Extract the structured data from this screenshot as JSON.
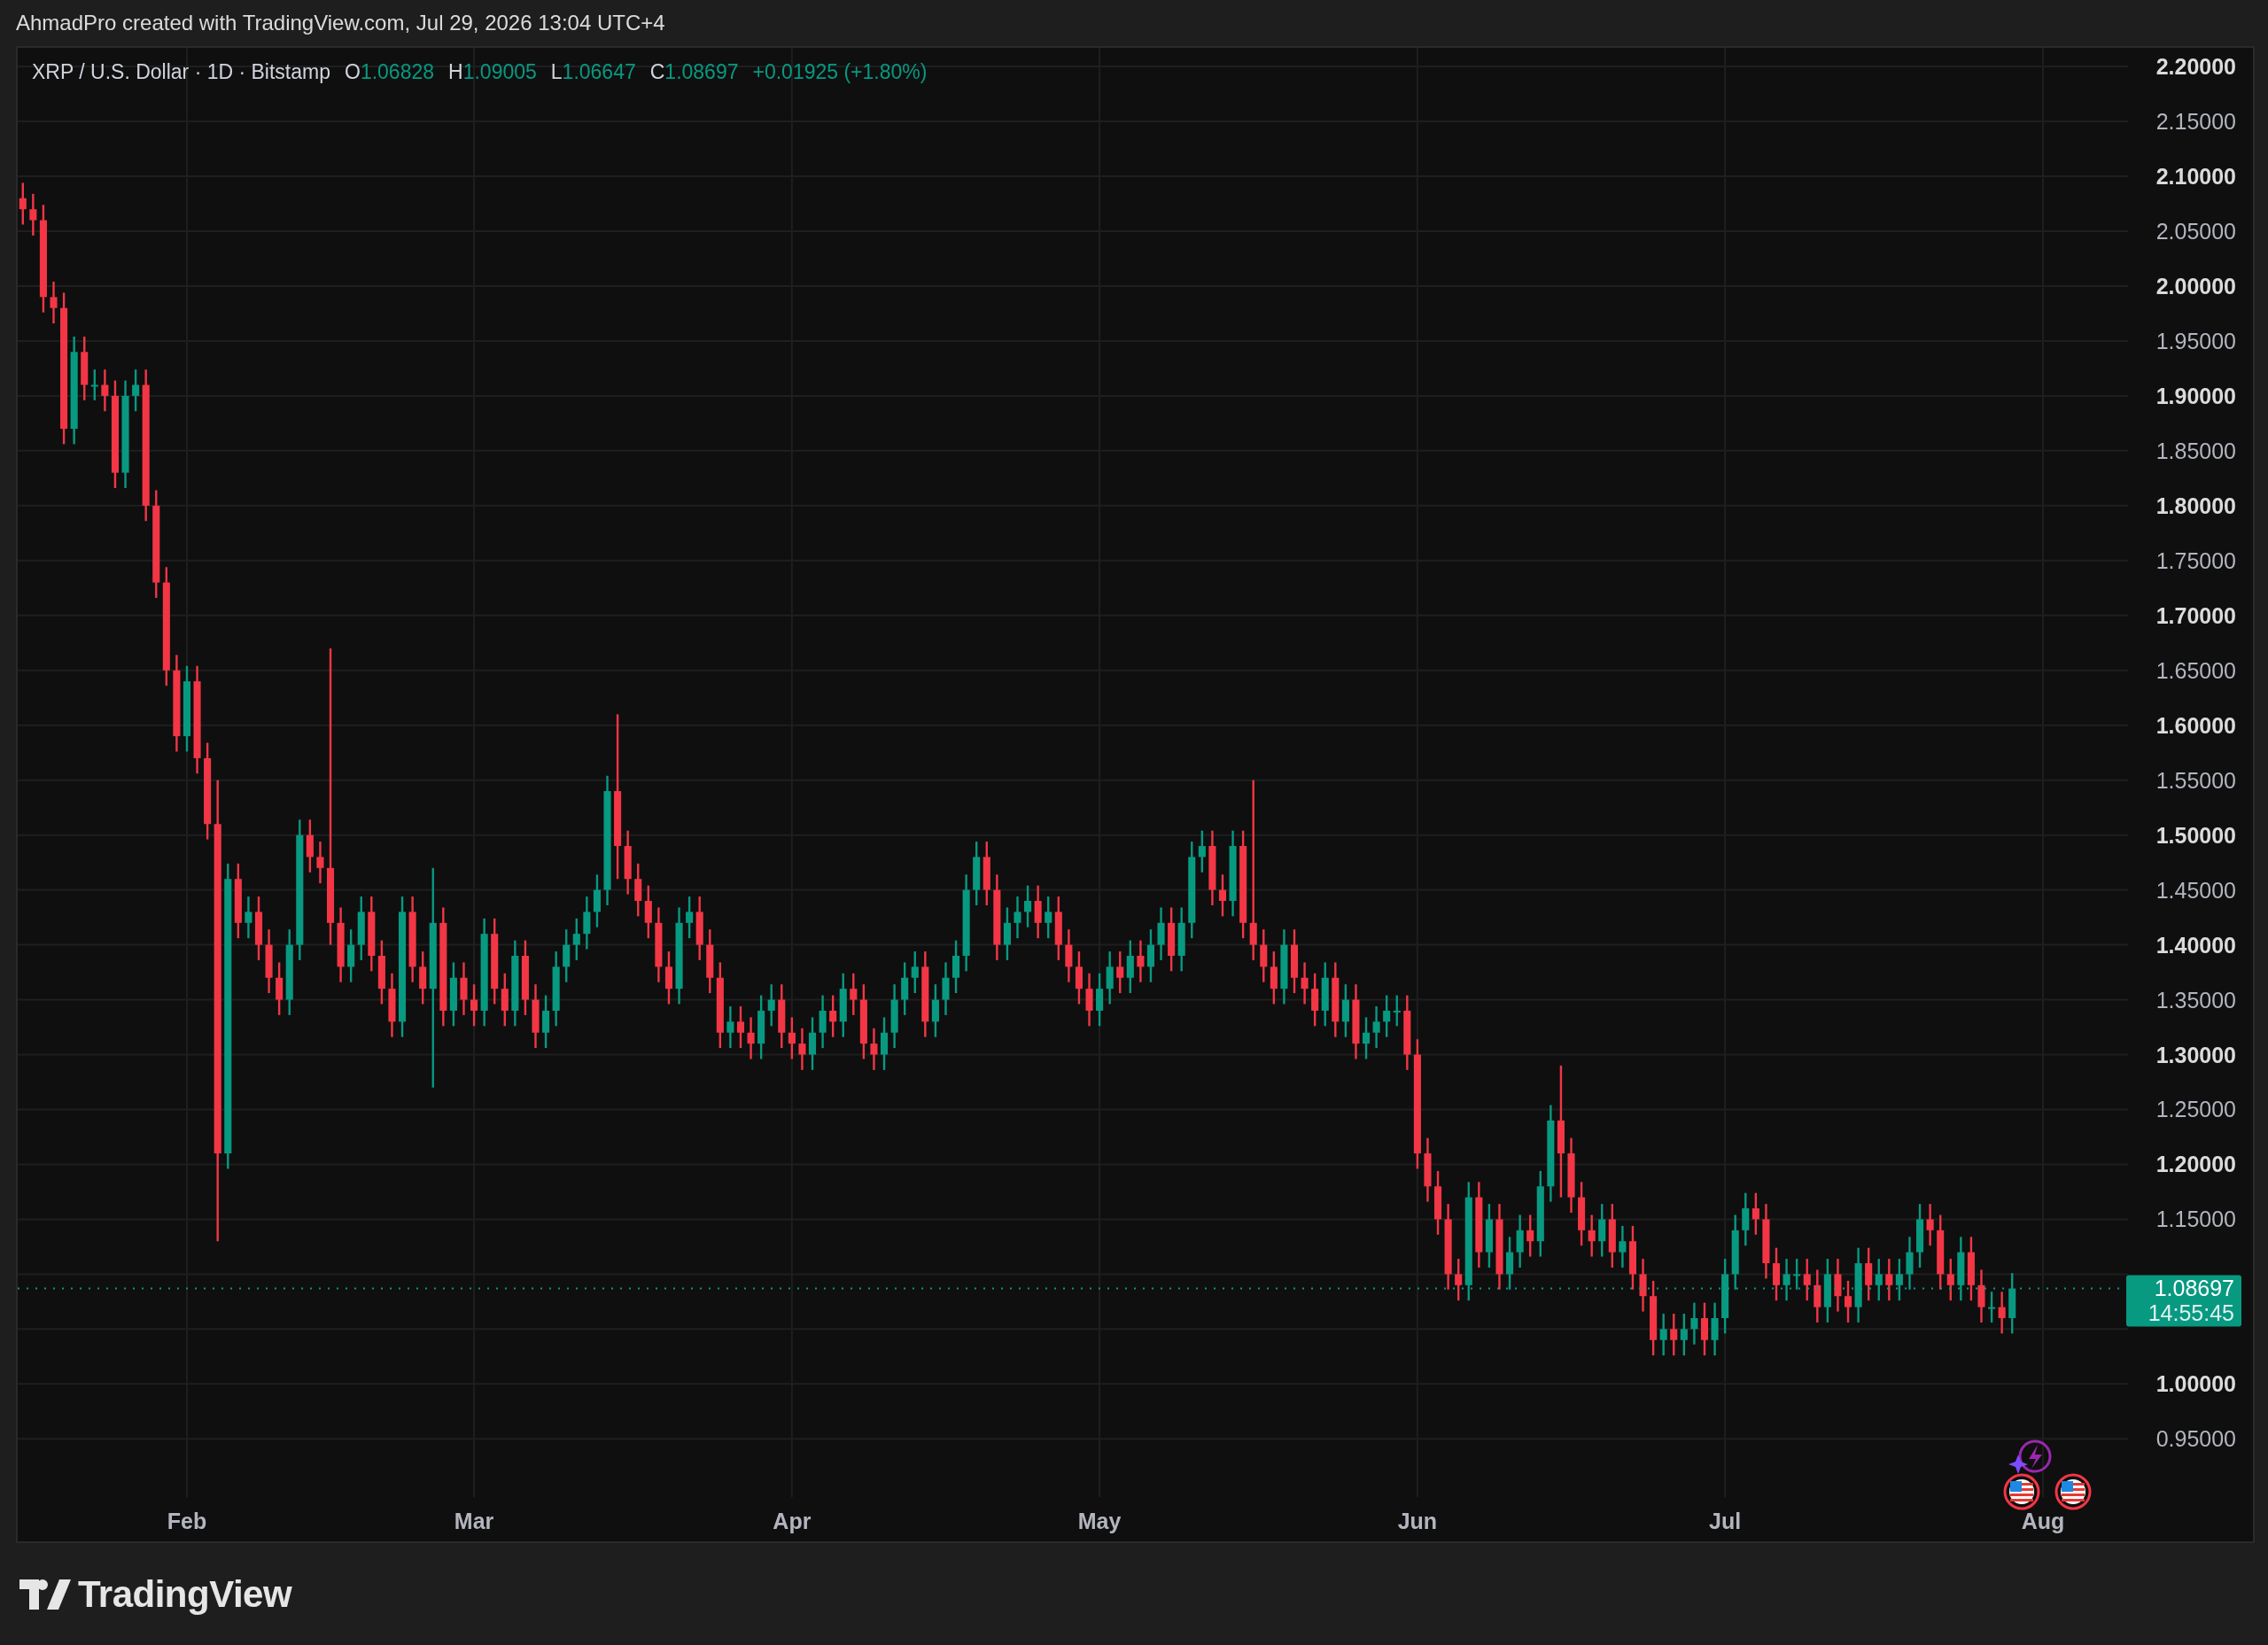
{
  "header": {
    "attribution": "AhmadPro created with TradingView.com, Jul 29, 2026 13:04 UTC+4"
  },
  "legend": {
    "symbol": "XRP / U.S. Dollar · 1D · Bitstamp",
    "values": [
      {
        "label": "O",
        "value": "1.06828"
      },
      {
        "label": "H",
        "value": "1.09005"
      },
      {
        "label": "L",
        "value": "1.06647"
      },
      {
        "label": "C",
        "value": "1.08697"
      }
    ],
    "change": "+0.01925 (+1.80%)"
  },
  "chart": {
    "price_tag": {
      "price": "1.08697",
      "countdown": "14:55:45"
    },
    "price_axis": [
      "2.20000",
      "2.15000",
      "2.10000",
      "2.05000",
      "2.00000",
      "1.95000",
      "1.90000",
      "1.85000",
      "1.80000",
      "1.75000",
      "1.70000",
      "1.65000",
      "1.60000",
      "1.55000",
      "1.50000",
      "1.45000",
      "1.40000",
      "1.35000",
      "1.30000",
      "1.25000",
      "1.20000",
      "1.15000",
      "1.00000",
      "0.95000"
    ],
    "time_axis": [
      "Feb",
      "Mar",
      "Apr",
      "May",
      "Jun",
      "Jul",
      "Aug"
    ]
  },
  "footer": {
    "logo": "TradingView"
  }
}
